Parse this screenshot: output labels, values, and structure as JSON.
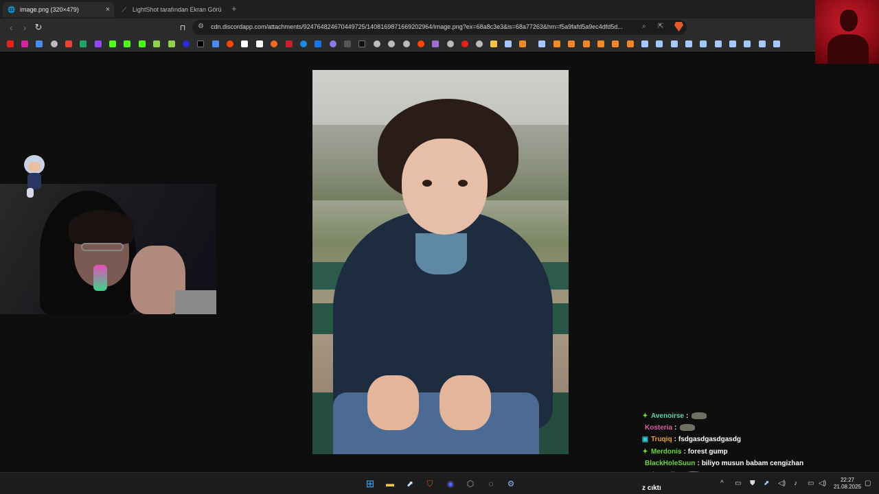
{
  "browser": {
    "tabs": [
      {
        "title": "image.png (320×479)",
        "active": true,
        "icon": "globe-icon"
      },
      {
        "title": "LightShot tarafından Ekran Görüntüsü",
        "active": false,
        "icon": "feather-icon"
      }
    ],
    "new_tab_label": "+",
    "close_label": "×",
    "address": "cdn.discordapp.com/attachments/924764824670449725/1408169871669202964/image.png?ex=68a8c3e3&is=68a77263&hm=f5a9fafd5a9ec4dfd5d...",
    "accent_color": "#e05a2b"
  },
  "chat": {
    "messages": [
      {
        "user": "Avenoirse",
        "color": "#5fd4a8",
        "badge": "✦",
        "badge_color": "#6fd33c",
        "text": "",
        "emote": true
      },
      {
        "user": "Kosteria",
        "color": "#e05fa2",
        "badge": "",
        "badge_color": "",
        "text": "",
        "emote": true
      },
      {
        "user": "Truqiq",
        "color": "#e8a12d",
        "badge": "▣",
        "badge_color": "#36c8d8",
        "text": "fsdgasdgasdgasdg",
        "emote": false
      },
      {
        "user": "Merdonis",
        "color": "#6fd33c",
        "badge": "✦",
        "badge_color": "#6fd33c",
        "text": "forest gump",
        "emote": false
      },
      {
        "user": "BlackHoleSuun",
        "color": "#6fd33c",
        "badge": "",
        "badge_color": "",
        "text": "biliyo musun babam cengizhan",
        "emote": false
      },
      {
        "user": "aybenmila",
        "color": "#5fd4a8",
        "badge": "",
        "badge_color": "",
        "text": "",
        "emote": true
      }
    ],
    "partial_line": "z cıktı"
  },
  "taskbar": {
    "time": "22:27",
    "date": "21.08.2025",
    "apps": [
      "windows-start-icon",
      "file-explorer-icon",
      "steam-icon",
      "brave-icon",
      "discord-icon",
      "app-cube-icon",
      "app-circle-icon",
      "app-gear-icon"
    ]
  }
}
